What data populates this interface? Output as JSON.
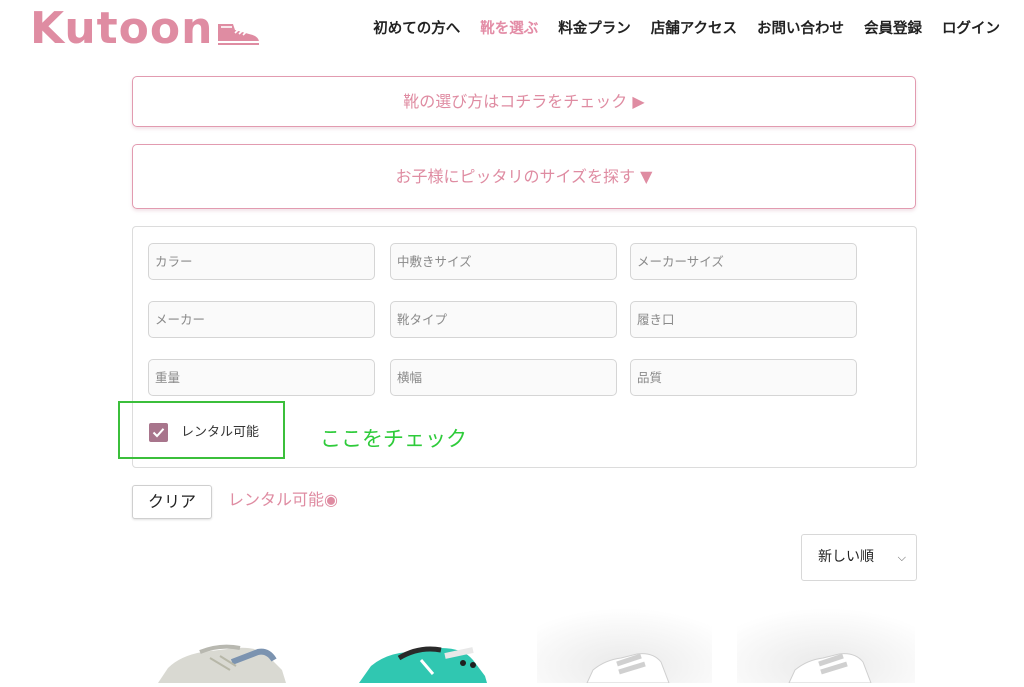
{
  "logo": {
    "text": "Kutoon"
  },
  "nav": {
    "items": [
      {
        "label": "初めての方へ"
      },
      {
        "label": "靴を選ぶ"
      },
      {
        "label": "料金プラン"
      },
      {
        "label": "店舗アクセス"
      },
      {
        "label": "お問い合わせ"
      },
      {
        "label": "会員登録"
      },
      {
        "label": "ログイン"
      }
    ],
    "active_index": 1
  },
  "guide_button": {
    "label": "靴の選び方はコチラをチェック ▶"
  },
  "size_button": {
    "label": "お子様にピッタリのサイズを探す ▼"
  },
  "filters": {
    "fields": [
      {
        "placeholder": "カラー"
      },
      {
        "placeholder": "中敷きサイズ"
      },
      {
        "placeholder": "メーカーサイズ"
      },
      {
        "placeholder": "メーカー"
      },
      {
        "placeholder": "靴タイプ"
      },
      {
        "placeholder": "履き口"
      },
      {
        "placeholder": "重量"
      },
      {
        "placeholder": "横幅"
      },
      {
        "placeholder": "品質"
      }
    ],
    "rental": {
      "label": "レンタル可能",
      "checked": true
    }
  },
  "annotation": {
    "text": "ここをチェック"
  },
  "clear_button": {
    "label": "クリア"
  },
  "active_filter": {
    "label": "レンタル可能◉"
  },
  "sort": {
    "selected": "新しい順"
  },
  "colors": {
    "brand_pink": "#df8ca2",
    "checkbox": "#a8758c",
    "annotation_green": "#2ecb3a"
  }
}
